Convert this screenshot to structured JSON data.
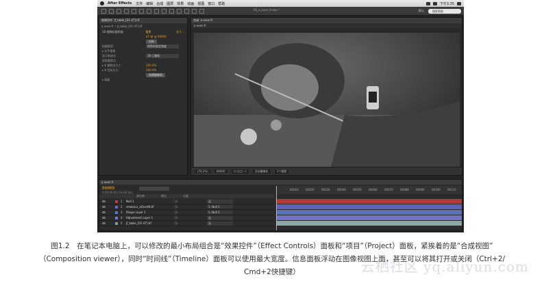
{
  "menubar": {
    "app_name": "After Effects",
    "items": [
      "文件",
      "编辑",
      "合成",
      "图层",
      "效果",
      "动画",
      "视图",
      "窗口",
      "帮助"
    ],
    "time": "下午3:35"
  },
  "toolbar": {
    "window_title": "05_a_oven_fr.aep *",
    "workspace": "默认",
    "search_placeholder": "搜索帮助"
  },
  "effect_controls": {
    "tab": "效果控件: jf_table_[01-47].tif",
    "subtitle": "a oven fr • jf_table_[01-47].tif",
    "effect_name": "3D 摄像机跟踪器",
    "reset": "重置",
    "about": "关于...",
    "rows": [
      {
        "label": "",
        "value": "47 帧 @ 00000",
        "kind": "value"
      },
      {
        "label": "",
        "value": "分析",
        "kind": "button"
      },
      {
        "label": "拍摄类型",
        "value": "视角的固定角度",
        "kind": "dropdown"
      },
      {
        "label": "▸ 水平视角",
        "value": "",
        "kind": "value"
      },
      {
        "label": "显示轨迹点",
        "value": "3D 已解析",
        "kind": "dropdown"
      },
      {
        "label": "渲染跟踪点",
        "value": "",
        "kind": "value"
      },
      {
        "label": "▸ ⏱ 跟踪点大小",
        "value": "100.0%",
        "kind": "value"
      },
      {
        "label": "▸ ⏱ 目标大小",
        "value": "100.0%",
        "kind": "value"
      },
      {
        "label": "",
        "value": "创建摄像机",
        "kind": "button"
      },
      {
        "label": "▸ 高级",
        "value": "",
        "kind": "value"
      }
    ]
  },
  "composition": {
    "tab": "合成: a oven fr",
    "breadcrumb": "a oven fr",
    "zoom": "(76.2%)",
    "timecode": "00000",
    "quality": "(二分之一)",
    "camera": "活动摄像机",
    "views": "1个视图"
  },
  "timeline": {
    "tab": "a oven fr",
    "timecode": "00000",
    "fps": "0:00:00:00 (24.00 fps)",
    "col_source": "源名称",
    "col_switches": "模式",
    "col_parent": "父级",
    "ruler_ticks": [
      "00010",
      "00020",
      "00030",
      "00040",
      "00050",
      "00060",
      "00070",
      "00080",
      "00090",
      "00100",
      "00110"
    ],
    "layers": [
      {
        "num": "1",
        "name": "Null 1",
        "parent": "无",
        "color": "#c03a3a",
        "bar": "#b43a3a"
      },
      {
        "num": "2",
        "name": "smokeur_aOvenN.tif",
        "parent": "1. Null 1",
        "color": "#6a6ad0",
        "bar": "#6262b8"
      },
      {
        "num": "3",
        "name": "Shape Layer 1",
        "parent": "1. Null 1",
        "color": "#5a76c4",
        "bar": "#5a72b8"
      },
      {
        "num": "4",
        "name": "Adjustment Layer 1",
        "parent": "无",
        "color": "#7a7ad6",
        "bar": "#7474c6"
      },
      {
        "num": "5",
        "name": "jf_table_[01-47].tif",
        "parent": "无",
        "color": "#7aa0a0",
        "bar": "#8aa8a8"
      }
    ]
  },
  "caption": {
    "line1": "图1.2　在笔记本电脑上，可以修改的最小布局组合是“效果控件”（Effect Controls）面板和“项目”（Project）面板，紧挨着的是“合成视图”",
    "line2": "（Composition viewer），同时“时间线”（Timeline）面板可以使用最大宽度。信息面板浮动在图像视图上面，甚至可以将其打开或关闭（Ctrl+2/",
    "line3": "Cmd+2快捷键）"
  },
  "watermark": "云栖社区 yq.aliyun.com"
}
